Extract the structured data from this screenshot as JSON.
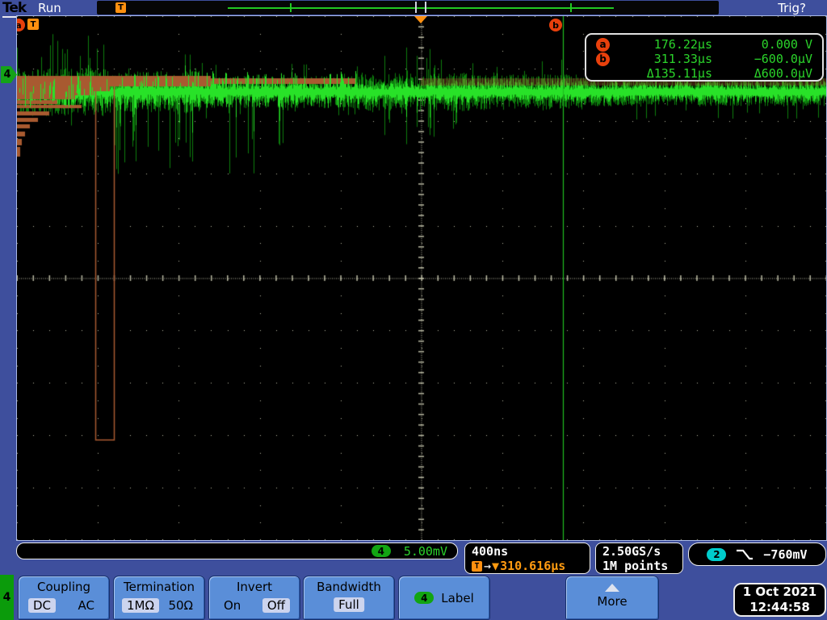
{
  "top_bar": {
    "logo": "Tek",
    "acq_status": "Run",
    "trig_status": "Trig?",
    "preview_trigger": "T"
  },
  "plot_markers": {
    "cursor_a": "a",
    "trigger_offscreen": "T",
    "cursor_b": "b",
    "channel_4": "4"
  },
  "cursor_readout": {
    "a_label": "a",
    "a_time": "176.22µs",
    "a_volt": "0.000 V",
    "b_label": "b",
    "b_time": "311.33µs",
    "b_volt": "−600.0µV",
    "delta_time": "Δ135.11µs",
    "delta_volt": "Δ600.0µV"
  },
  "status_bar": {
    "channel": "4",
    "vertical_scale": "5.00mV",
    "timebase": "400ns",
    "delay_trigger": "T",
    "delay_arrow": "→",
    "delay_marker": "▼",
    "delay_value": "310.616µs",
    "sample_rate": "2.50GS/s",
    "record_length": "1M points",
    "trigger_channel": "2",
    "trigger_level": "−760mV"
  },
  "menu": {
    "channel_tab": "4",
    "buttons": [
      {
        "title": "Coupling",
        "options": [
          "DC",
          "AC"
        ],
        "selected": "DC"
      },
      {
        "title": "Termination",
        "options": [
          "1MΩ",
          "50Ω"
        ],
        "selected": "1MΩ"
      },
      {
        "title": "Invert",
        "options": [
          "On",
          "Off"
        ],
        "selected": "Off"
      },
      {
        "title": "Bandwidth",
        "options": [
          "Full"
        ],
        "selected": "Full"
      },
      {
        "title": "Label",
        "channel": "4"
      },
      {
        "title": "More"
      }
    ],
    "datetime": {
      "date": "1 Oct 2021",
      "time": "12:44:58"
    }
  },
  "colors": {
    "chassis_blue": "#3e4f9d",
    "button_blue": "#5a8ed8",
    "waveform_green": "#22e022",
    "trace_brown": "#a85a30",
    "readout_green": "#2bd42b",
    "orange": "#ff9a10",
    "cursor_red": "#e8400c",
    "channel2_cyan": "#00cccc",
    "channel4_green": "#12a512"
  }
}
